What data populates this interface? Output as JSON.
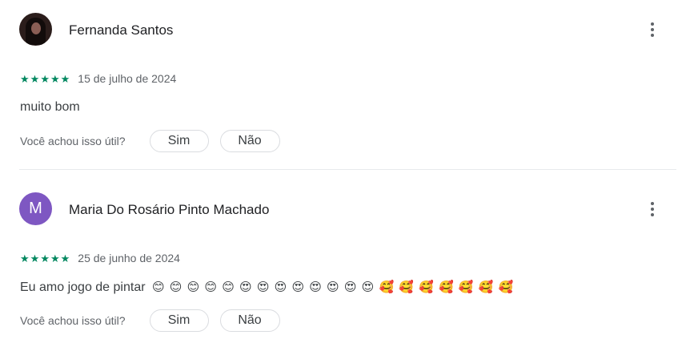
{
  "reviews": [
    {
      "avatar": {
        "type": "photo"
      },
      "name": "Fernanda Santos",
      "rating": 5,
      "stars": "★★★★★",
      "date": "15 de julho de 2024",
      "text": "muito bom",
      "emojis": "",
      "helpful_question": "Você achou isso útil?",
      "yes_label": "Sim",
      "no_label": "Não"
    },
    {
      "avatar": {
        "type": "letter",
        "letter": "M",
        "color": "#7e57c2"
      },
      "name": "Maria Do Rosário Pinto Machado",
      "rating": 5,
      "stars": "★★★★★",
      "date": "25 de junho de 2024",
      "text": "Eu amo jogo de pintar",
      "emojis": "😊 😊 😊 😊 😊 😍 😍 😍 😍 😍 😍 😍 😍 🥰 🥰 🥰 🥰 🥰 🥰 🥰",
      "helpful_question": "Você achou isso útil?",
      "yes_label": "Sim",
      "no_label": "Não"
    }
  ],
  "colors": {
    "star": "#01875f",
    "secondary_text": "#5f6368",
    "border": "#dadce0"
  },
  "icons": {
    "more": "more-vert-icon",
    "star": "star-icon"
  }
}
